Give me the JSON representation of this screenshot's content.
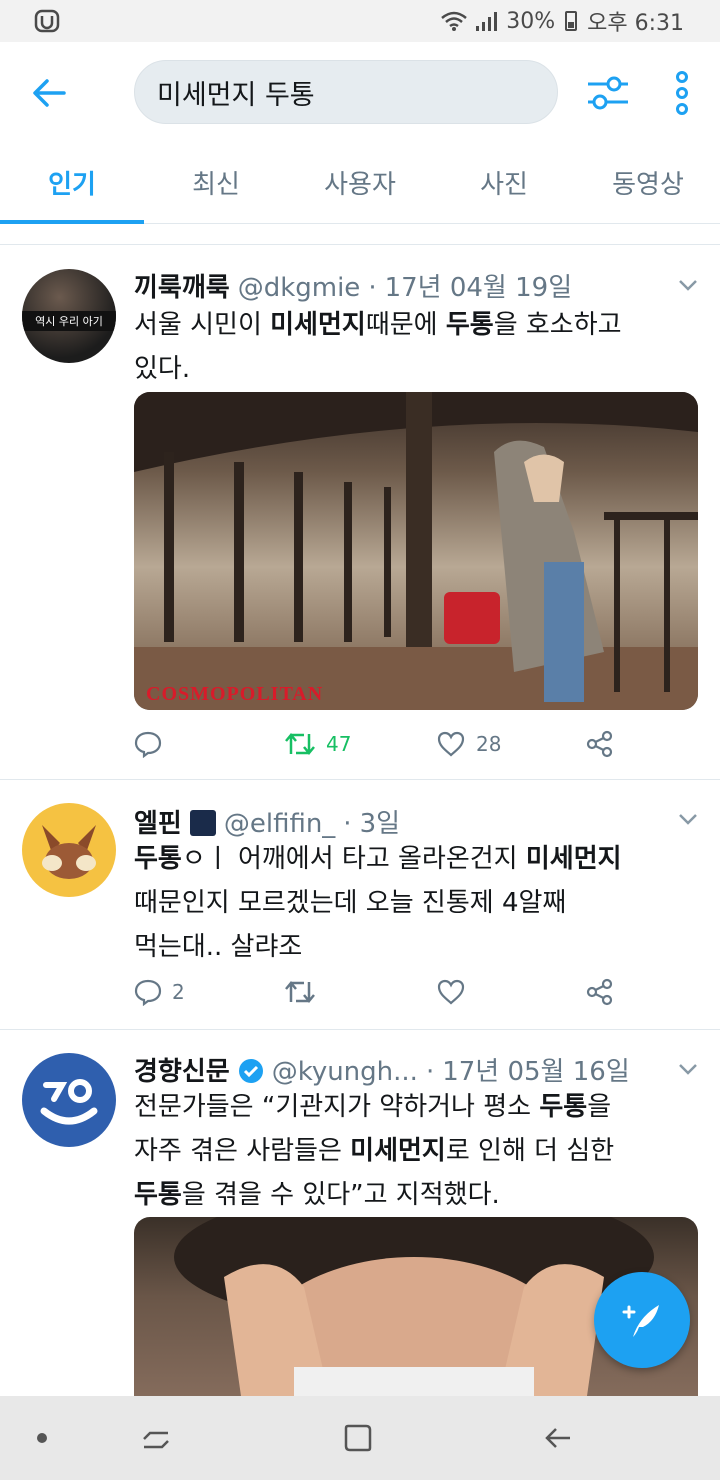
{
  "status_bar": {
    "battery": "30%",
    "time": "오후 6:31"
  },
  "header": {
    "back_icon": "arrow-left-icon",
    "search_value": "미세먼지 두통",
    "filter_icon": "filter-sliders-icon",
    "more_icon": "more-vertical-icon",
    "accent_color": "#1da1f2"
  },
  "tabs": [
    {
      "label": "인기",
      "active": true
    },
    {
      "label": "최신",
      "active": false
    },
    {
      "label": "사진",
      "active": false
    },
    {
      "label": "사용자",
      "active": false
    },
    {
      "label": "동영상",
      "active": false
    }
  ],
  "tweets": [
    {
      "name": "끼룩깨룩",
      "handle": "@dkgmie",
      "dot": "·",
      "date": "17년 04월 19일",
      "avatar_text": "역시 우리 아기",
      "body_lines": [
        [
          "서울 시민이 ",
          "미세먼지",
          "때문에 ",
          "두통",
          "을 호소하고"
        ],
        [
          "있다."
        ]
      ],
      "media_text": "COSMOPOLITAN",
      "actions": {
        "reply": "",
        "retweet": "47",
        "like": "28"
      }
    },
    {
      "name": "엘핀",
      "handle": "@elfifin_",
      "dot": "·",
      "date": "3일",
      "body_lines": [
        [
          "두통",
          "ㅇㅣ 어깨에서 타고 올라온건지 ",
          "미세먼지"
        ],
        [
          "때문인지 모르겠는데 오늘 진통제 4알째"
        ],
        [
          "먹는대.. 살랴조"
        ]
      ],
      "actions": {
        "reply": "2",
        "retweet": "",
        "like": ""
      }
    },
    {
      "name": "경향신문",
      "handle": "@kyungh...",
      "dot": "·",
      "date": "17년 05월 16일",
      "avatar_text": "경",
      "body_lines": [
        [
          "전문가들은 “기관지가 약하거나 평소 ",
          "두통",
          "을"
        ],
        [
          "자주 겪은 사람들은 ",
          "미세먼지",
          "로 인해 더 심한"
        ],
        [
          "두통",
          "을 겪을 수 있다”고 지적했다."
        ]
      ]
    }
  ],
  "fab": {
    "icon": "compose-tweet-icon"
  },
  "nav_bar": {
    "icons": [
      "dot-icon",
      "recents-icon",
      "home-icon",
      "back-icon"
    ]
  }
}
